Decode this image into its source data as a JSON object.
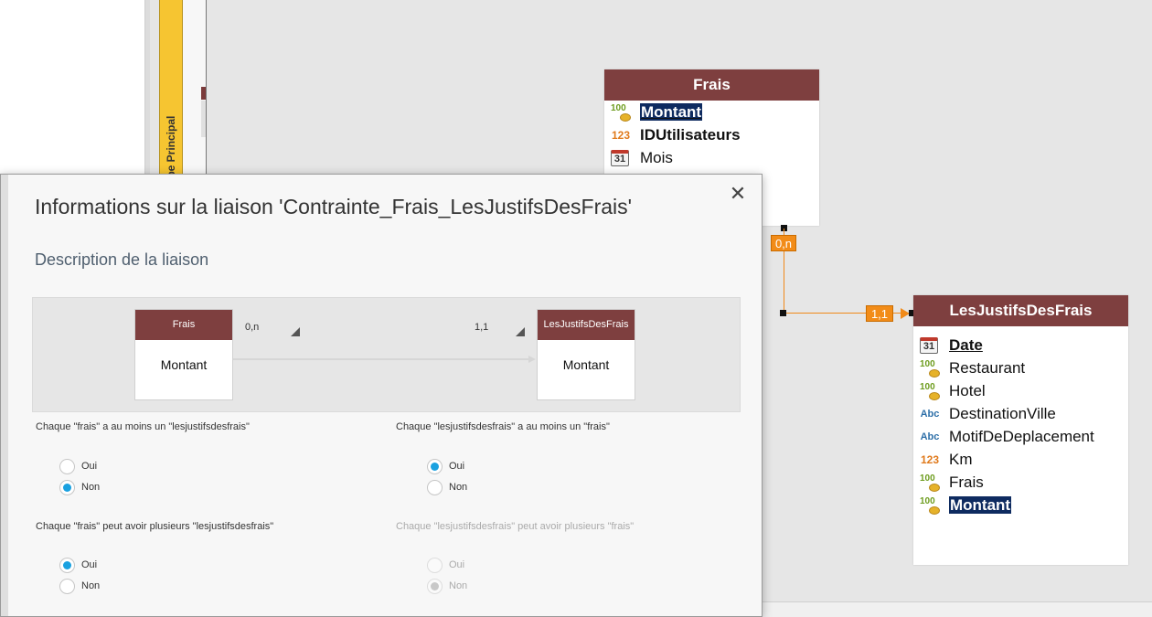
{
  "background": {
    "group_label": "Groupe Principal",
    "entity_frais": {
      "title": "Frais",
      "fields": [
        {
          "icon": "money-icon",
          "label": "Montant"
        },
        {
          "icon": "number-icon",
          "label": "IDUtilisateurs"
        },
        {
          "icon": "calendar-icon",
          "label": "Mois"
        }
      ]
    },
    "entity_justifs": {
      "title": "LesJustifsDesFrais",
      "fields": [
        {
          "icon": "calendar-icon",
          "label": "Date"
        },
        {
          "icon": "money-icon",
          "label": "Restaurant"
        },
        {
          "icon": "money-icon",
          "label": "Hotel"
        },
        {
          "icon": "text-icon",
          "label": "DestinationVille"
        },
        {
          "icon": "text-icon",
          "label": "MotifDeDeplacement"
        },
        {
          "icon": "number-icon",
          "label": "Km"
        },
        {
          "icon": "money-icon",
          "label": "Frais"
        },
        {
          "icon": "money-icon",
          "label": "Montant"
        }
      ]
    },
    "cardinality_frais": "0,n",
    "cardinality_justifs": "1,1",
    "icon_glyphs": {
      "money": "100",
      "number": "123",
      "text": "Abc",
      "calendar": "31"
    }
  },
  "dialog": {
    "title": "Informations sur la liaison 'Contrainte_Frais_LesJustifsDesFrais'",
    "close_glyph": "✕",
    "subtitle": "Description de la liaison",
    "diagram": {
      "left_entity": {
        "title": "Frais",
        "field": "Montant"
      },
      "right_entity": {
        "title": "LesJustifsDesFrais",
        "field": "Montant"
      },
      "left_cardinality": "0,n",
      "right_cardinality": "1,1"
    },
    "questions": [
      {
        "text": "Chaque \"frais\" a au moins un \"lesjustifsdesfrais\"",
        "options": [
          "Oui",
          "Non"
        ],
        "selected": "Non",
        "disabled": false
      },
      {
        "text": "Chaque \"lesjustifsdesfrais\" a au moins un \"frais\"",
        "options": [
          "Oui",
          "Non"
        ],
        "selected": "Oui",
        "disabled": false
      },
      {
        "text": "Chaque \"frais\" peut avoir plusieurs \"lesjustifsdesfrais\"",
        "options": [
          "Oui",
          "Non"
        ],
        "selected": "Oui",
        "disabled": false
      },
      {
        "text": "Chaque \"lesjustifsdesfrais\" peut avoir plusieurs \"frais\"",
        "options": [
          "Oui",
          "Non"
        ],
        "selected": "Non",
        "disabled": true
      }
    ]
  },
  "colors": {
    "entity_header": "#7e3f3f",
    "connector": "#f08a1a",
    "radio_checked": "#1aa1e0",
    "group_bar": "#f6c531",
    "selection": "#0e2b60"
  }
}
